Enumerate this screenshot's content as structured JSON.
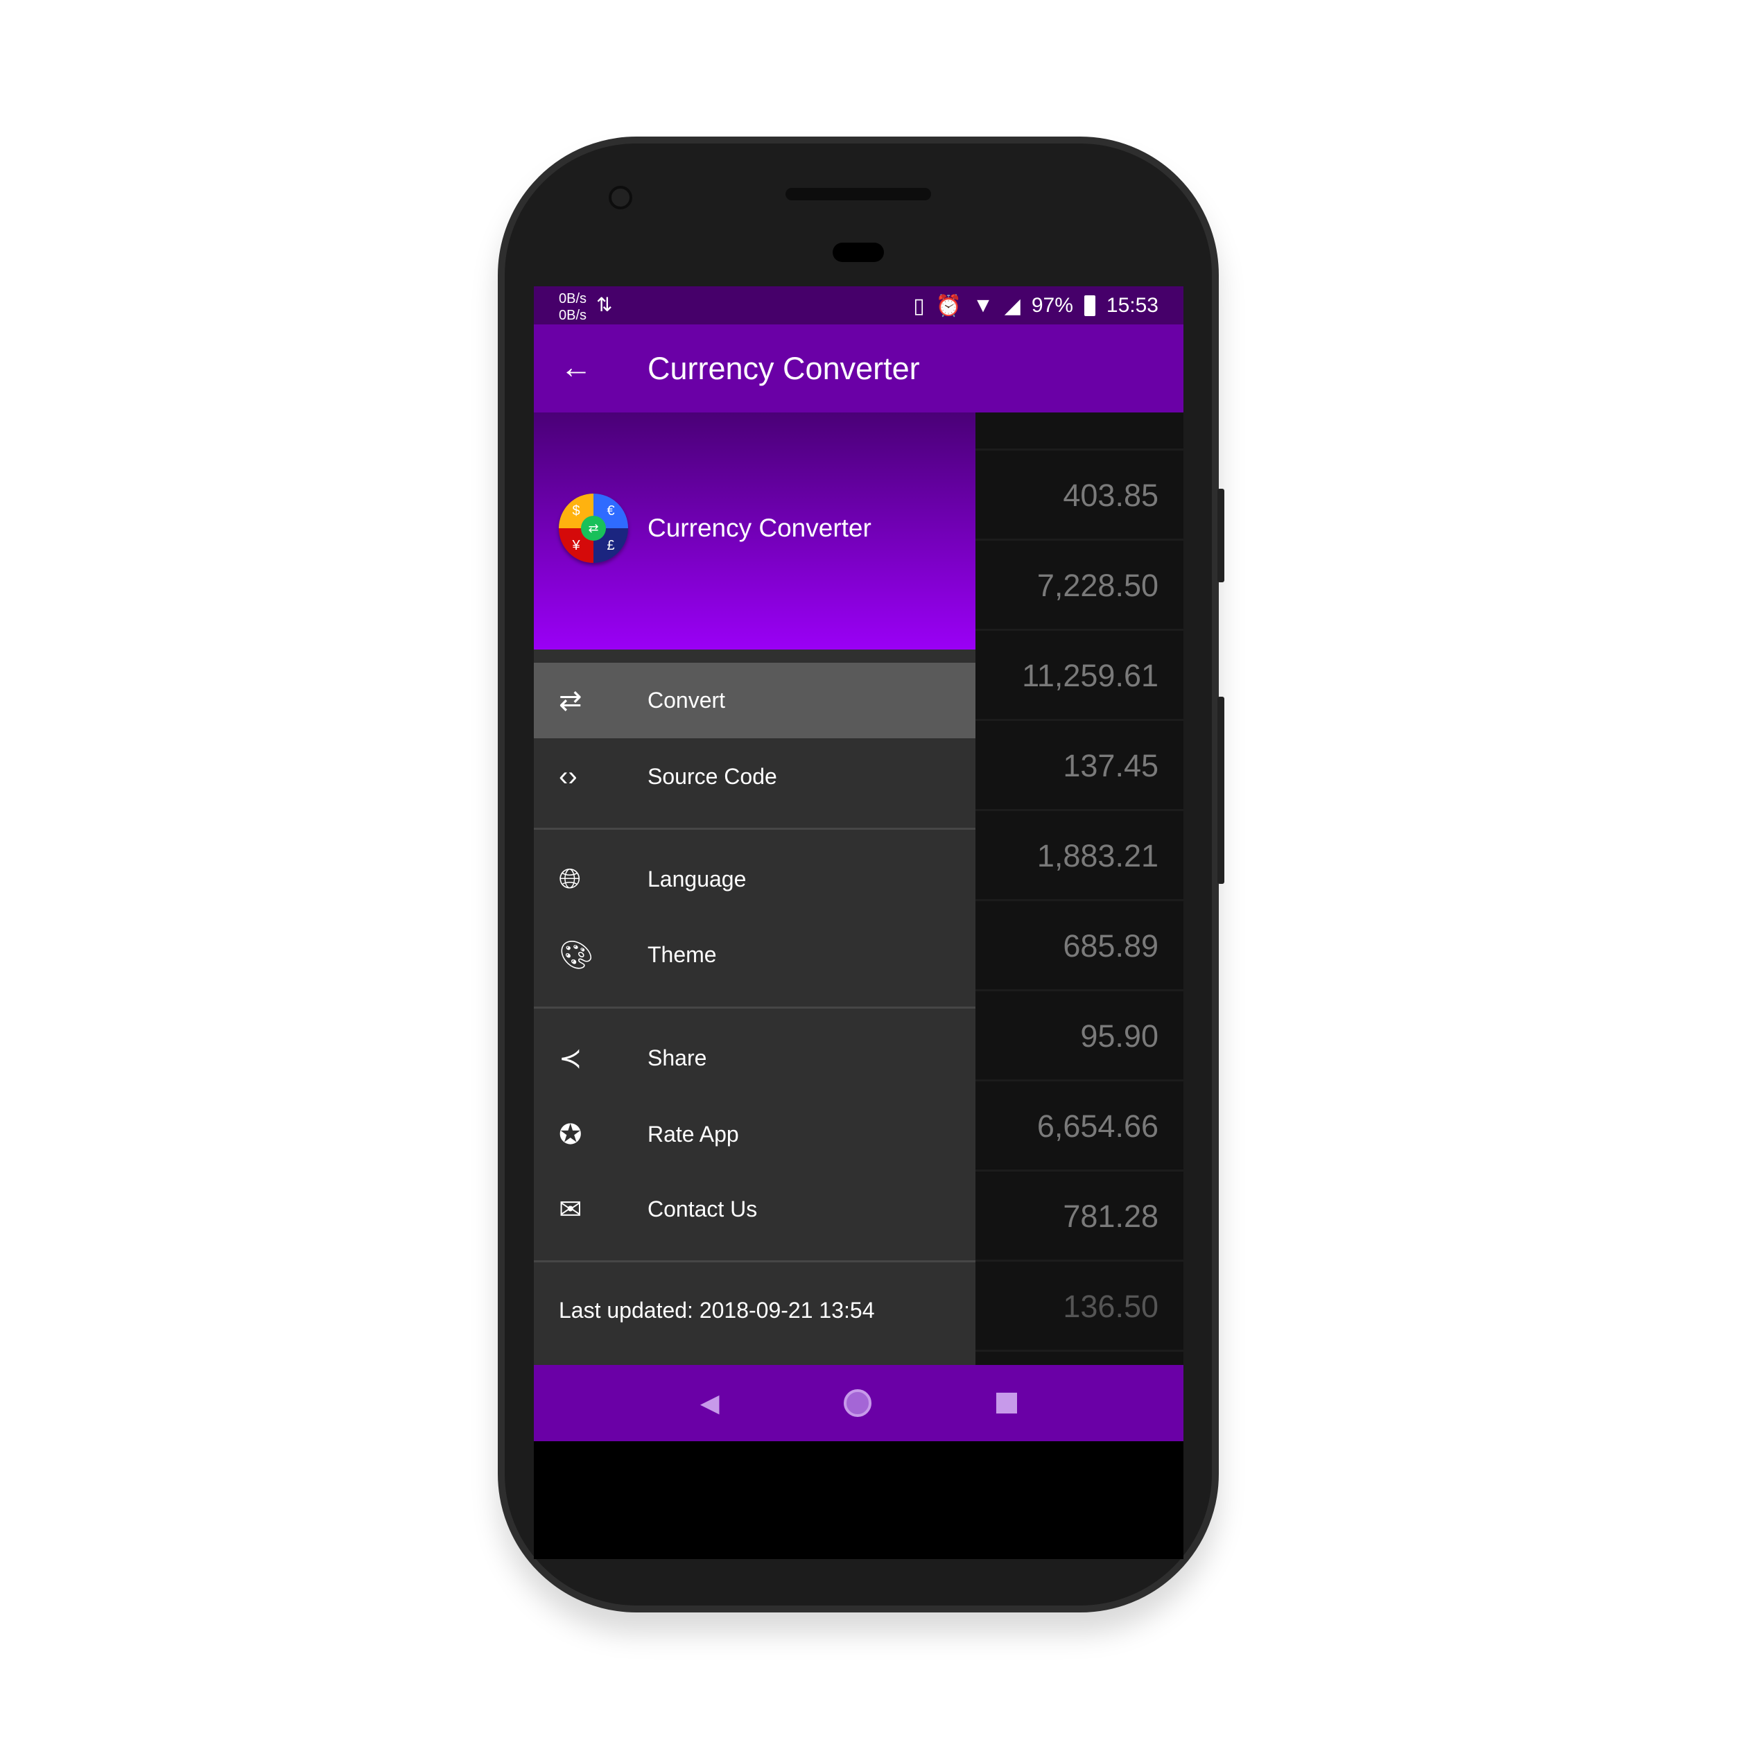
{
  "status_bar": {
    "net_up": "0B/s",
    "net_down": "0B/s",
    "battery": "97%",
    "time": "15:53"
  },
  "toolbar": {
    "title": "Currency Converter"
  },
  "drawer": {
    "header_title": "Currency Converter",
    "logo_symbols": [
      "$",
      "€",
      "¥",
      "£"
    ],
    "items": [
      {
        "label": "Convert",
        "icon": "swap-icon",
        "selected": true
      },
      {
        "label": "Source Code",
        "icon": "code-icon"
      },
      {
        "label": "Language",
        "icon": "globe-icon"
      },
      {
        "label": "Theme",
        "icon": "palette-icon"
      },
      {
        "label": "Share",
        "icon": "share-icon"
      },
      {
        "label": "Rate App",
        "icon": "star-icon"
      },
      {
        "label": "Contact Us",
        "icon": "mail-icon"
      }
    ],
    "last_updated": "Last updated: 2018-09-21 13:54"
  },
  "values": [
    "403.85",
    "7,228.50",
    "11,259.61",
    "137.45",
    "1,883.21",
    "685.89",
    "95.90",
    "6,654.66",
    "781.28",
    "136.50"
  ],
  "colors": {
    "primary": "#6a00a6",
    "status": "#46006a",
    "drawer": "#303030",
    "selected": "#5a5a5a"
  }
}
